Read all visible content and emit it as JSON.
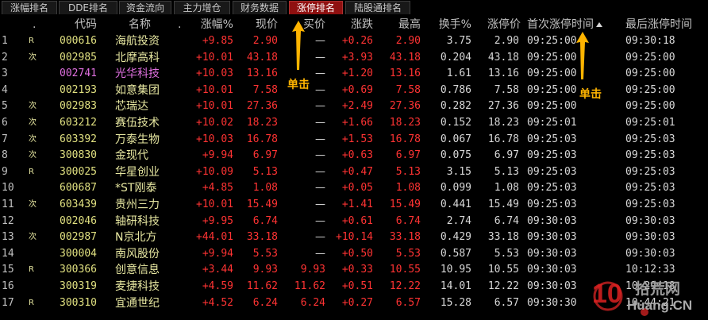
{
  "tabs": [
    "涨幅排名",
    "DDE排名",
    "资金流向",
    "主力增仓",
    "财务数据",
    "涨停排名",
    "陆股通排名"
  ],
  "active_tab": 5,
  "headers": {
    "dot": ".",
    "code": "代码",
    "name": "名称",
    "dot2": ".",
    "zhangfu": "涨幅%",
    "xianjia": "现价",
    "maijia": "买价",
    "zhangdie": "涨跌",
    "zuigao": "最高",
    "huanshou": "换手%",
    "zhangting": "涨停价",
    "first_time": "首次涨停时间",
    "last_time": "最后涨停时间"
  },
  "annotations": [
    "单击",
    "单击"
  ],
  "watermark": {
    "num": "10",
    "text_cn": "拾荒网",
    "text_en": "Huang.CN"
  },
  "rows": [
    {
      "i": "1",
      "f": "R",
      "code": "000616",
      "name": "海航投资",
      "zf": "+9.85",
      "xj": "2.90",
      "mj": "—",
      "zd": "+0.26",
      "zg": "2.90",
      "hs": "3.75",
      "zt": "2.90",
      "t1": "09:25:00",
      "t2": "09:30:18"
    },
    {
      "i": "2",
      "f": "次",
      "code": "002985",
      "name": "北摩高科",
      "zf": "+10.01",
      "xj": "43.18",
      "mj": "—",
      "zd": "+3.93",
      "zg": "43.18",
      "hs": "0.204",
      "zt": "43.18",
      "t1": "09:25:00",
      "t2": "09:25:00"
    },
    {
      "i": "3",
      "f": "",
      "code": "002741",
      "name": "光华科技",
      "zf": "+10.03",
      "xj": "13.16",
      "mj": "—",
      "zd": "+1.20",
      "zg": "13.16",
      "hs": "1.61",
      "zt": "13.16",
      "t1": "09:25:00",
      "t2": "09:25:00",
      "pink": true
    },
    {
      "i": "4",
      "f": "",
      "code": "002193",
      "name": "如意集团",
      "zf": "+10.01",
      "xj": "7.58",
      "mj": "—",
      "zd": "+0.69",
      "zg": "7.58",
      "hs": "0.786",
      "zt": "7.58",
      "t1": "09:25:00",
      "t2": "09:25:00"
    },
    {
      "i": "5",
      "f": "次",
      "code": "002983",
      "name": "芯瑞达",
      "zf": "+10.01",
      "xj": "27.36",
      "mj": "—",
      "zd": "+2.49",
      "zg": "27.36",
      "hs": "0.282",
      "zt": "27.36",
      "t1": "09:25:00",
      "t2": "09:25:00"
    },
    {
      "i": "6",
      "f": "次",
      "code": "603212",
      "name": "赛伍技术",
      "zf": "+10.02",
      "xj": "18.23",
      "mj": "—",
      "zd": "+1.66",
      "zg": "18.23",
      "hs": "0.152",
      "zt": "18.23",
      "t1": "09:25:01",
      "t2": "09:25:01"
    },
    {
      "i": "7",
      "f": "次",
      "code": "603392",
      "name": "万泰生物",
      "zf": "+10.03",
      "xj": "16.78",
      "mj": "—",
      "zd": "+1.53",
      "zg": "16.78",
      "hs": "0.067",
      "zt": "16.78",
      "t1": "09:25:03",
      "t2": "09:25:03"
    },
    {
      "i": "8",
      "f": "次",
      "code": "300830",
      "name": "金现代",
      "zf": "+9.94",
      "xj": "6.97",
      "mj": "—",
      "zd": "+0.63",
      "zg": "6.97",
      "hs": "0.075",
      "zt": "6.97",
      "t1": "09:25:03",
      "t2": "09:25:03"
    },
    {
      "i": "9",
      "f": "R",
      "code": "300025",
      "name": "华星创业",
      "zf": "+10.09",
      "xj": "5.13",
      "mj": "—",
      "zd": "+0.47",
      "zg": "5.13",
      "hs": "3.15",
      "zt": "5.13",
      "t1": "09:25:03",
      "t2": "09:25:03"
    },
    {
      "i": "10",
      "f": "",
      "code": "600687",
      "name": "*ST刚泰",
      "zf": "+4.85",
      "xj": "1.08",
      "mj": "—",
      "zd": "+0.05",
      "zg": "1.08",
      "hs": "0.099",
      "zt": "1.08",
      "t1": "09:25:03",
      "t2": "09:25:03"
    },
    {
      "i": "11",
      "f": "次",
      "code": "603439",
      "name": "贵州三力",
      "zf": "+10.01",
      "xj": "15.49",
      "mj": "—",
      "zd": "+1.41",
      "zg": "15.49",
      "hs": "0.441",
      "zt": "15.49",
      "t1": "09:25:03",
      "t2": "09:25:03"
    },
    {
      "i": "12",
      "f": "",
      "code": "002046",
      "name": "轴研科技",
      "zf": "+9.95",
      "xj": "6.74",
      "mj": "—",
      "zd": "+0.61",
      "zg": "6.74",
      "hs": "2.74",
      "zt": "6.74",
      "t1": "09:30:03",
      "t2": "09:30:03"
    },
    {
      "i": "13",
      "f": "次",
      "code": "002987",
      "name": "N京北方",
      "zf": "+44.01",
      "xj": "33.18",
      "mj": "—",
      "zd": "+10.14",
      "zg": "33.18",
      "hs": "0.429",
      "zt": "33.18",
      "t1": "09:30:03",
      "t2": "09:30:03"
    },
    {
      "i": "14",
      "f": "",
      "code": "300004",
      "name": "南风股份",
      "zf": "+9.94",
      "xj": "5.53",
      "mj": "—",
      "zd": "+0.50",
      "zg": "5.53",
      "hs": "0.587",
      "zt": "5.53",
      "t1": "09:30:03",
      "t2": "09:30:03"
    },
    {
      "i": "15",
      "f": "R",
      "code": "300366",
      "name": "创意信息",
      "zf": "+3.44",
      "xj": "9.93",
      "mj": "9.93",
      "zd": "+0.33",
      "zg": "10.55",
      "hs": "10.95",
      "zt": "10.55",
      "t1": "09:30:03",
      "t2": "10:12:33"
    },
    {
      "i": "16",
      "f": "",
      "code": "300319",
      "name": "麦捷科技",
      "zf": "+4.59",
      "xj": "11.62",
      "mj": "11.62",
      "zd": "+0.51",
      "zg": "12.22",
      "hs": "14.01",
      "zt": "12.22",
      "t1": "09:30:03",
      "t2": "10:29:18"
    },
    {
      "i": "17",
      "f": "R",
      "code": "300310",
      "name": "宜通世纪",
      "zf": "+4.52",
      "xj": "6.24",
      "mj": "6.24",
      "zd": "+0.27",
      "zg": "6.57",
      "hs": "15.28",
      "zt": "6.57",
      "t1": "09:30:30",
      "t2": "10:44:21"
    }
  ]
}
